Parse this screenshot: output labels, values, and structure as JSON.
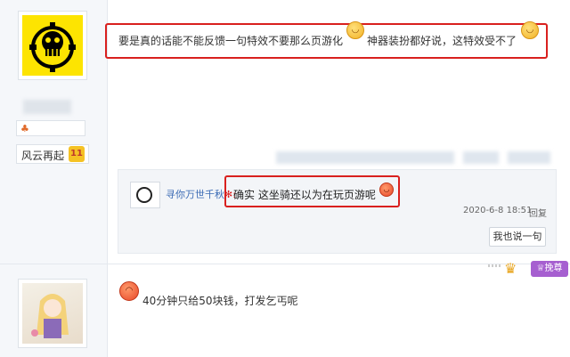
{
  "post1": {
    "text_part1": "要是真的话能不能反馈一句特效不要那么页游化",
    "text_part2": "神器装扮都好说，这特效受不了",
    "author_badge": "风云再起",
    "level": "11"
  },
  "reply": {
    "username": "寻你万世千秋",
    "username_suffix": "✻:",
    "text": "确实 这坐骑还以为在玩页游呢",
    "date": "2020-6-8 18:51",
    "action_label": "回复",
    "say_button_label": "我也说一句"
  },
  "post2": {
    "text": "40分钟只给50块钱，打发乞丐呢"
  },
  "vip_badge_label": "挽尊",
  "colors": {
    "highlight_border": "#d9201e",
    "link_blue": "#3b6bb5",
    "vip_purple": "#a65fd0"
  },
  "icons": {
    "avatar1": "one-piece-jolly-roger-avatar",
    "avatar2": "anime-girl-avatar",
    "emoji": "smile-face-emoji",
    "crown": "crown-icon"
  }
}
